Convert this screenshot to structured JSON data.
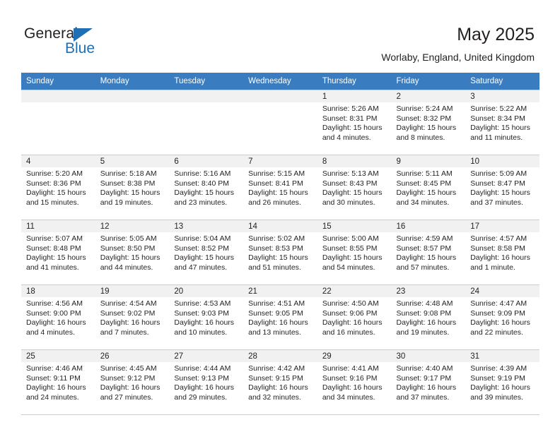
{
  "brand": {
    "name_part1": "General",
    "name_part2": "Blue",
    "triangle_icon": "triangle-icon"
  },
  "header": {
    "title": "May 2025",
    "subtitle": "Worlaby, England, United Kingdom"
  },
  "colors": {
    "header_blue": "#3a7cc0",
    "brand_blue": "#1f6fb5",
    "daynum_bg": "#f1f1f1",
    "grid_line": "#bfcfe0",
    "text": "#231f20"
  },
  "weekday_headers": [
    "Sunday",
    "Monday",
    "Tuesday",
    "Wednesday",
    "Thursday",
    "Friday",
    "Saturday"
  ],
  "weeks": [
    [
      {
        "day": "",
        "sunrise": "",
        "sunset": "",
        "daylight1": "",
        "daylight2": ""
      },
      {
        "day": "",
        "sunrise": "",
        "sunset": "",
        "daylight1": "",
        "daylight2": ""
      },
      {
        "day": "",
        "sunrise": "",
        "sunset": "",
        "daylight1": "",
        "daylight2": ""
      },
      {
        "day": "",
        "sunrise": "",
        "sunset": "",
        "daylight1": "",
        "daylight2": ""
      },
      {
        "day": "1",
        "sunrise": "Sunrise: 5:26 AM",
        "sunset": "Sunset: 8:31 PM",
        "daylight1": "Daylight: 15 hours",
        "daylight2": "and 4 minutes."
      },
      {
        "day": "2",
        "sunrise": "Sunrise: 5:24 AM",
        "sunset": "Sunset: 8:32 PM",
        "daylight1": "Daylight: 15 hours",
        "daylight2": "and 8 minutes."
      },
      {
        "day": "3",
        "sunrise": "Sunrise: 5:22 AM",
        "sunset": "Sunset: 8:34 PM",
        "daylight1": "Daylight: 15 hours",
        "daylight2": "and 11 minutes."
      }
    ],
    [
      {
        "day": "4",
        "sunrise": "Sunrise: 5:20 AM",
        "sunset": "Sunset: 8:36 PM",
        "daylight1": "Daylight: 15 hours",
        "daylight2": "and 15 minutes."
      },
      {
        "day": "5",
        "sunrise": "Sunrise: 5:18 AM",
        "sunset": "Sunset: 8:38 PM",
        "daylight1": "Daylight: 15 hours",
        "daylight2": "and 19 minutes."
      },
      {
        "day": "6",
        "sunrise": "Sunrise: 5:16 AM",
        "sunset": "Sunset: 8:40 PM",
        "daylight1": "Daylight: 15 hours",
        "daylight2": "and 23 minutes."
      },
      {
        "day": "7",
        "sunrise": "Sunrise: 5:15 AM",
        "sunset": "Sunset: 8:41 PM",
        "daylight1": "Daylight: 15 hours",
        "daylight2": "and 26 minutes."
      },
      {
        "day": "8",
        "sunrise": "Sunrise: 5:13 AM",
        "sunset": "Sunset: 8:43 PM",
        "daylight1": "Daylight: 15 hours",
        "daylight2": "and 30 minutes."
      },
      {
        "day": "9",
        "sunrise": "Sunrise: 5:11 AM",
        "sunset": "Sunset: 8:45 PM",
        "daylight1": "Daylight: 15 hours",
        "daylight2": "and 34 minutes."
      },
      {
        "day": "10",
        "sunrise": "Sunrise: 5:09 AM",
        "sunset": "Sunset: 8:47 PM",
        "daylight1": "Daylight: 15 hours",
        "daylight2": "and 37 minutes."
      }
    ],
    [
      {
        "day": "11",
        "sunrise": "Sunrise: 5:07 AM",
        "sunset": "Sunset: 8:48 PM",
        "daylight1": "Daylight: 15 hours",
        "daylight2": "and 41 minutes."
      },
      {
        "day": "12",
        "sunrise": "Sunrise: 5:05 AM",
        "sunset": "Sunset: 8:50 PM",
        "daylight1": "Daylight: 15 hours",
        "daylight2": "and 44 minutes."
      },
      {
        "day": "13",
        "sunrise": "Sunrise: 5:04 AM",
        "sunset": "Sunset: 8:52 PM",
        "daylight1": "Daylight: 15 hours",
        "daylight2": "and 47 minutes."
      },
      {
        "day": "14",
        "sunrise": "Sunrise: 5:02 AM",
        "sunset": "Sunset: 8:53 PM",
        "daylight1": "Daylight: 15 hours",
        "daylight2": "and 51 minutes."
      },
      {
        "day": "15",
        "sunrise": "Sunrise: 5:00 AM",
        "sunset": "Sunset: 8:55 PM",
        "daylight1": "Daylight: 15 hours",
        "daylight2": "and 54 minutes."
      },
      {
        "day": "16",
        "sunrise": "Sunrise: 4:59 AM",
        "sunset": "Sunset: 8:57 PM",
        "daylight1": "Daylight: 15 hours",
        "daylight2": "and 57 minutes."
      },
      {
        "day": "17",
        "sunrise": "Sunrise: 4:57 AM",
        "sunset": "Sunset: 8:58 PM",
        "daylight1": "Daylight: 16 hours",
        "daylight2": "and 1 minute."
      }
    ],
    [
      {
        "day": "18",
        "sunrise": "Sunrise: 4:56 AM",
        "sunset": "Sunset: 9:00 PM",
        "daylight1": "Daylight: 16 hours",
        "daylight2": "and 4 minutes."
      },
      {
        "day": "19",
        "sunrise": "Sunrise: 4:54 AM",
        "sunset": "Sunset: 9:02 PM",
        "daylight1": "Daylight: 16 hours",
        "daylight2": "and 7 minutes."
      },
      {
        "day": "20",
        "sunrise": "Sunrise: 4:53 AM",
        "sunset": "Sunset: 9:03 PM",
        "daylight1": "Daylight: 16 hours",
        "daylight2": "and 10 minutes."
      },
      {
        "day": "21",
        "sunrise": "Sunrise: 4:51 AM",
        "sunset": "Sunset: 9:05 PM",
        "daylight1": "Daylight: 16 hours",
        "daylight2": "and 13 minutes."
      },
      {
        "day": "22",
        "sunrise": "Sunrise: 4:50 AM",
        "sunset": "Sunset: 9:06 PM",
        "daylight1": "Daylight: 16 hours",
        "daylight2": "and 16 minutes."
      },
      {
        "day": "23",
        "sunrise": "Sunrise: 4:48 AM",
        "sunset": "Sunset: 9:08 PM",
        "daylight1": "Daylight: 16 hours",
        "daylight2": "and 19 minutes."
      },
      {
        "day": "24",
        "sunrise": "Sunrise: 4:47 AM",
        "sunset": "Sunset: 9:09 PM",
        "daylight1": "Daylight: 16 hours",
        "daylight2": "and 22 minutes."
      }
    ],
    [
      {
        "day": "25",
        "sunrise": "Sunrise: 4:46 AM",
        "sunset": "Sunset: 9:11 PM",
        "daylight1": "Daylight: 16 hours",
        "daylight2": "and 24 minutes."
      },
      {
        "day": "26",
        "sunrise": "Sunrise: 4:45 AM",
        "sunset": "Sunset: 9:12 PM",
        "daylight1": "Daylight: 16 hours",
        "daylight2": "and 27 minutes."
      },
      {
        "day": "27",
        "sunrise": "Sunrise: 4:44 AM",
        "sunset": "Sunset: 9:13 PM",
        "daylight1": "Daylight: 16 hours",
        "daylight2": "and 29 minutes."
      },
      {
        "day": "28",
        "sunrise": "Sunrise: 4:42 AM",
        "sunset": "Sunset: 9:15 PM",
        "daylight1": "Daylight: 16 hours",
        "daylight2": "and 32 minutes."
      },
      {
        "day": "29",
        "sunrise": "Sunrise: 4:41 AM",
        "sunset": "Sunset: 9:16 PM",
        "daylight1": "Daylight: 16 hours",
        "daylight2": "and 34 minutes."
      },
      {
        "day": "30",
        "sunrise": "Sunrise: 4:40 AM",
        "sunset": "Sunset: 9:17 PM",
        "daylight1": "Daylight: 16 hours",
        "daylight2": "and 37 minutes."
      },
      {
        "day": "31",
        "sunrise": "Sunrise: 4:39 AM",
        "sunset": "Sunset: 9:19 PM",
        "daylight1": "Daylight: 16 hours",
        "daylight2": "and 39 minutes."
      }
    ]
  ]
}
